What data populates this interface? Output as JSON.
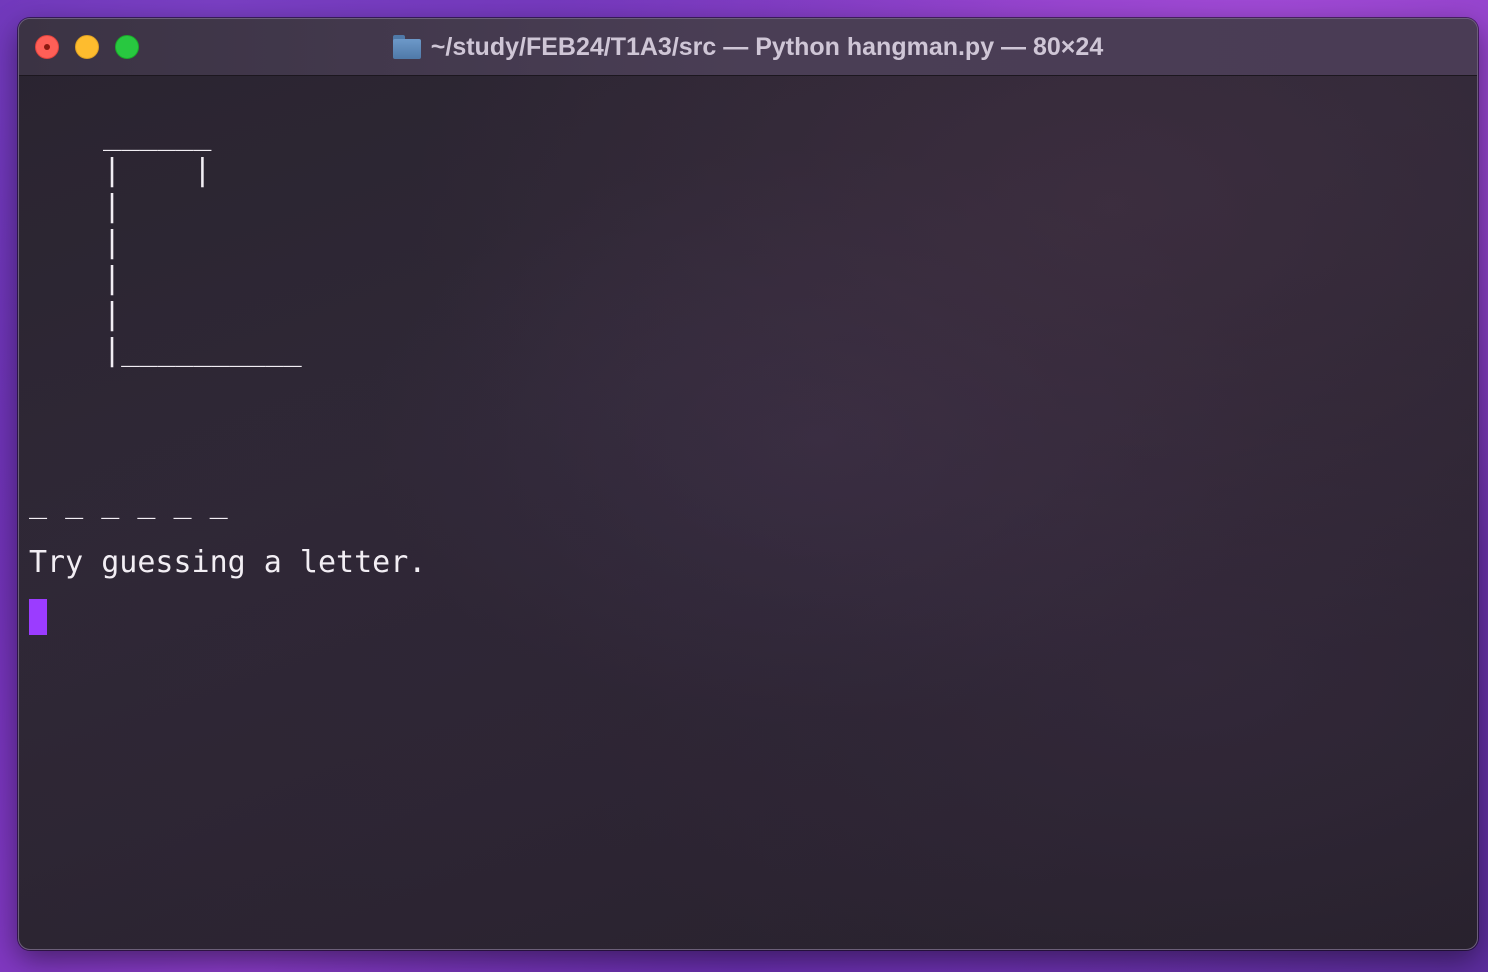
{
  "window": {
    "title": "~/study/FEB24/T1A3/src — Python hangman.py — 80×24",
    "folder_icon": "folder-icon",
    "controls": [
      "close",
      "minimize",
      "zoom"
    ]
  },
  "terminal": {
    "gallows_art": " ______\n |    |\n |\n |\n |\n |\n |__________",
    "word_blanks": "_ _ _ _ _ _",
    "prompt_message": "Try guessing a letter.",
    "cursor_color": "#9b3cff"
  },
  "colors": {
    "close": "#fe5f57",
    "minimize": "#febc2e",
    "zoom": "#28c840",
    "text": "#f2eef4"
  }
}
